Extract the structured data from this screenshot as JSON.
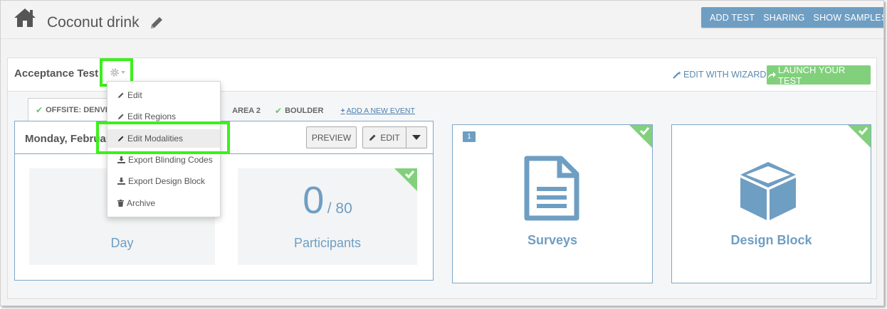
{
  "header": {
    "title": "Coconut drink",
    "actions": [
      "ADD TEST",
      "SHARING",
      "SHOW SAMPLES"
    ]
  },
  "panel": {
    "title": "Acceptance Test",
    "wizard_label": "EDIT WITH WIZARD",
    "launch_label": "LAUNCH YOUR TEST"
  },
  "tabs": [
    {
      "label": "OFFSITE: DENVER",
      "active": true
    },
    {
      "label": "AREA 2",
      "active": false
    },
    {
      "label": "BOULDER",
      "active": false
    }
  ],
  "add_event_label": "ADD A NEW EVENT",
  "day_card": {
    "title": "Monday, Februar",
    "preview_label": "PREVIEW",
    "edit_label": "EDIT",
    "day_stat_label": "Day",
    "participants_count": "0",
    "participants_total": "/ 80",
    "participants_label": "Participants"
  },
  "cards": {
    "surveys_badge": "1",
    "surveys_label": "Surveys",
    "design_label": "Design Block"
  },
  "dropdown": {
    "items": [
      "Edit",
      "Edit Regions",
      "Edit Modalities",
      "Export Blinding Codes",
      "Export Design Block",
      "Archive"
    ],
    "selected": "Edit Modalities"
  },
  "colors": {
    "accent": "#6f9ec3",
    "success": "#82d07c",
    "highlight": "#3cf01c"
  }
}
